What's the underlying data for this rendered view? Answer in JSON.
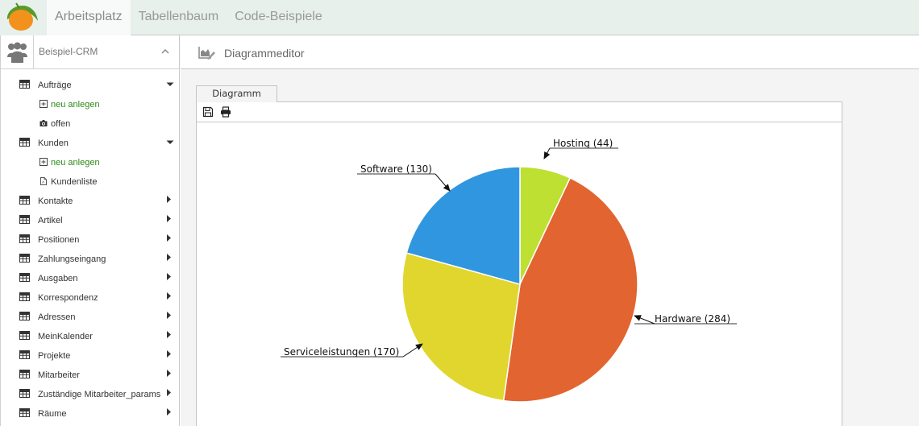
{
  "topnav": {
    "items": [
      {
        "label": "Arbeitsplatz",
        "active": true
      },
      {
        "label": "Tabellenbaum",
        "active": false
      },
      {
        "label": "Code-Beispiele",
        "active": false
      }
    ]
  },
  "sidebar": {
    "title": "Beispiel-CRM",
    "items": [
      {
        "label": "Aufträge",
        "icon": "table-icon",
        "arrow": "down",
        "level": 0
      },
      {
        "label": "neu anlegen",
        "icon": "plus-square-icon",
        "level": 1,
        "green": true
      },
      {
        "label": "offen",
        "icon": "camera-icon",
        "level": 1
      },
      {
        "label": "Kunden",
        "icon": "table-icon",
        "arrow": "down",
        "level": 0
      },
      {
        "label": "neu anlegen",
        "icon": "plus-square-icon",
        "level": 1,
        "green": true
      },
      {
        "label": "Kundenliste",
        "icon": "document-icon",
        "level": 1
      },
      {
        "label": "Kontakte",
        "icon": "table-icon",
        "arrow": "right",
        "level": 0
      },
      {
        "label": "Artikel",
        "icon": "table-icon",
        "arrow": "right",
        "level": 0
      },
      {
        "label": "Positionen",
        "icon": "table-icon",
        "arrow": "right",
        "level": 0
      },
      {
        "label": "Zahlungseingang",
        "icon": "table-icon",
        "arrow": "right",
        "level": 0
      },
      {
        "label": "Ausgaben",
        "icon": "table-icon",
        "arrow": "right",
        "level": 0
      },
      {
        "label": "Korrespondenz",
        "icon": "table-icon",
        "arrow": "right",
        "level": 0
      },
      {
        "label": "Adressen",
        "icon": "table-icon",
        "arrow": "right",
        "level": 0
      },
      {
        "label": "MeinKalender",
        "icon": "table-icon",
        "arrow": "right",
        "level": 0
      },
      {
        "label": "Projekte",
        "icon": "table-icon",
        "arrow": "right",
        "level": 0
      },
      {
        "label": "Mitarbeiter",
        "icon": "table-icon",
        "arrow": "right",
        "level": 0
      },
      {
        "label": "Zuständige Mitarbeiter_params",
        "icon": "table-icon",
        "arrow": "right",
        "level": 0
      },
      {
        "label": "Räume",
        "icon": "table-icon",
        "arrow": "right",
        "level": 0
      }
    ]
  },
  "main": {
    "title": "Diagrammeditor",
    "tab": "Diagramm",
    "toolbar": [
      {
        "name": "save-icon"
      },
      {
        "name": "print-icon"
      }
    ]
  },
  "colors": {
    "green_link": "#2a8a17"
  },
  "chart_data": {
    "type": "pie",
    "title": "",
    "start": "top",
    "direction": "clockwise",
    "slices": [
      {
        "label": "Hosting",
        "value": 44,
        "color": "#bde032",
        "display": "Hosting (44)"
      },
      {
        "label": "Hardware",
        "value": 284,
        "color": "#e26430",
        "display": "Hardware (284)"
      },
      {
        "label": "Serviceleistungen",
        "value": 170,
        "color": "#e1d62e",
        "display": "Serviceleistungen (170)"
      },
      {
        "label": "Software",
        "value": 130,
        "color": "#3196e0",
        "display": "Software (130)"
      }
    ]
  }
}
